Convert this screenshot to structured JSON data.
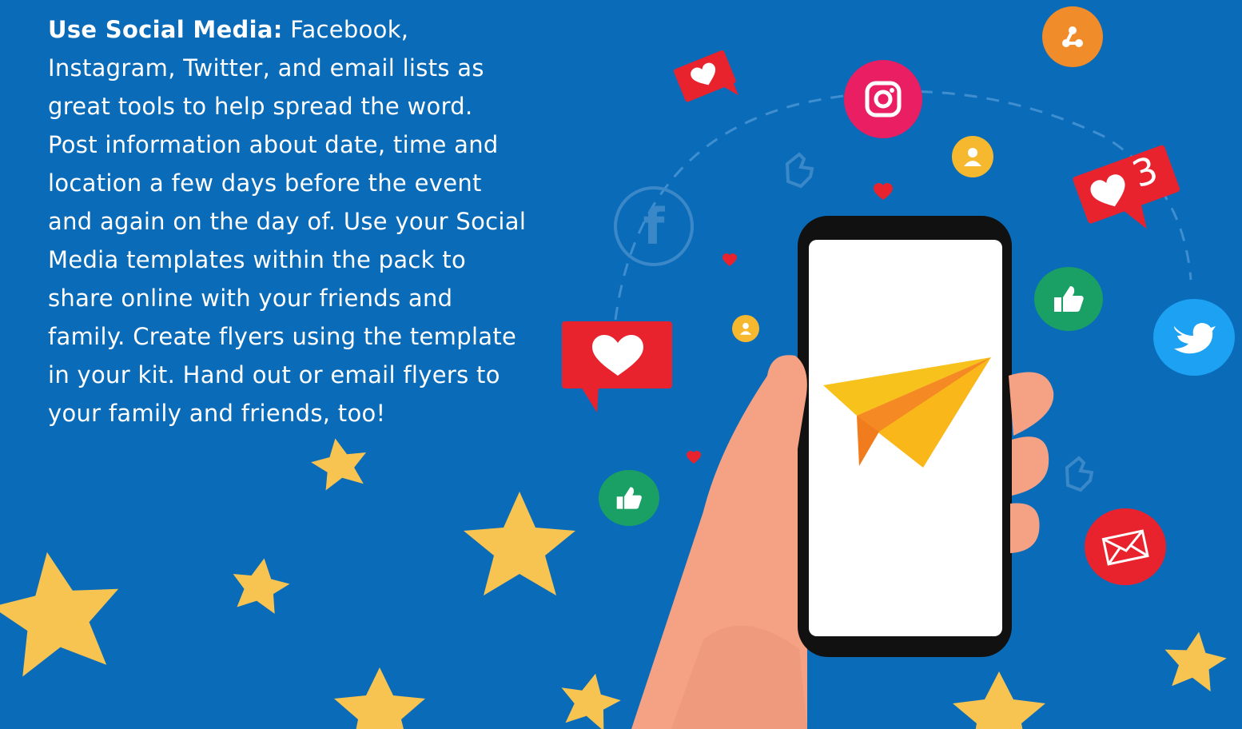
{
  "content": {
    "lead": "Use Social Media:",
    "body": " Facebook, Instagram, Twitter, and email lists as great tools to help spread the word. Post information about date, time and location a few days before the event and again on the day of. Use your Social Media templates within the pack to share online with your friends and family. Create flyers using the template in your kit. Hand out or email flyers to your family and friends, too!"
  },
  "notification_count": "3",
  "colors": {
    "background": "#0a6bb8",
    "star": "#f7c451",
    "red": "#e8232e",
    "instagram": "#e91e63",
    "green": "#1aa064",
    "orange": "#f08c2a",
    "yellow": "#f5b82e",
    "twitter": "#1da1f2"
  },
  "icons": [
    "facebook-icon",
    "instagram-icon",
    "share-icon",
    "user-icon",
    "heart-icon",
    "like-icon",
    "twitter-icon",
    "mail-icon",
    "paper-plane-icon"
  ]
}
